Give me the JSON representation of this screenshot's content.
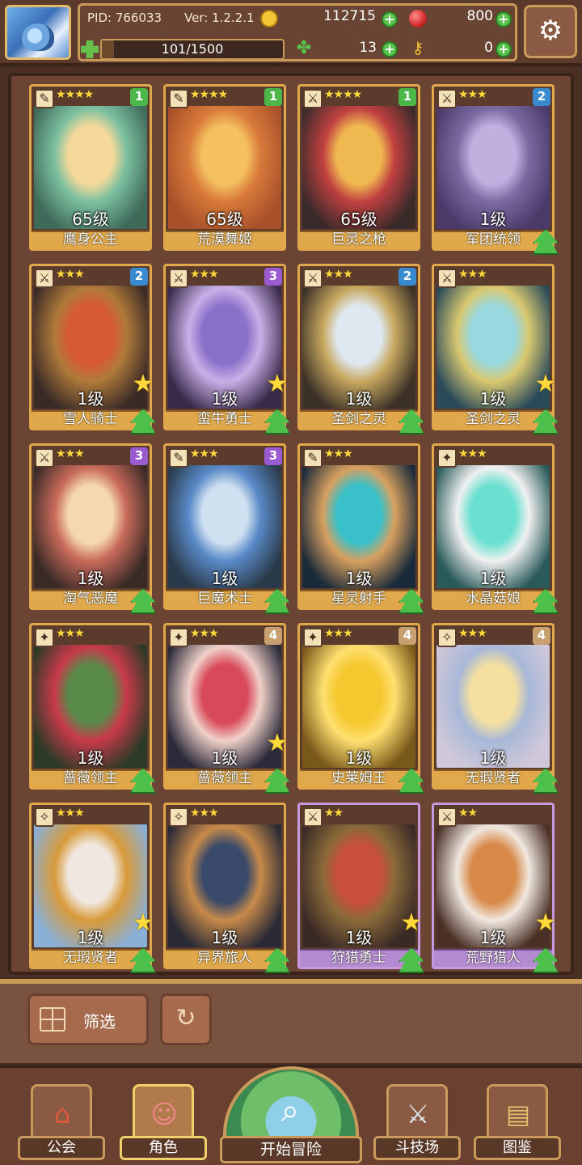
{
  "header": {
    "pid": "PID: 766033",
    "version": "Ver: 1.2.2.1",
    "coins": "112715",
    "gems": "800",
    "exp": "101/1500",
    "exp_progress": 0.067,
    "clover": "13",
    "keys": "0"
  },
  "cards": [
    {
      "name": "鹰身公主",
      "level": "65级",
      "stars": "★★★★",
      "rank": "1",
      "rank_color": "#4cb84a",
      "art": [
        "#3f6a5a",
        "#f5d99a",
        "#7cc0a0"
      ],
      "frame": "gold",
      "cls": "✎",
      "star_badge": false,
      "up_badge": false
    },
    {
      "name": "荒漠舞姬",
      "level": "65级",
      "stars": "★★★★",
      "rank": "1",
      "rank_color": "#4cb84a",
      "art": [
        "#a8502a",
        "#f5c060",
        "#d87a3a"
      ],
      "frame": "gold",
      "cls": "✎",
      "star_badge": false,
      "up_badge": false
    },
    {
      "name": "巨灵之枪",
      "level": "65级",
      "stars": "★★★★",
      "rank": "1",
      "rank_color": "#4cb84a",
      "art": [
        "#3a2a2a",
        "#f0b850",
        "#c04040"
      ],
      "frame": "gold",
      "cls": "⚔",
      "star_badge": false,
      "up_badge": false
    },
    {
      "name": "军团统领",
      "level": "1级",
      "stars": "★★★",
      "rank": "2",
      "rank_color": "#3a8ad0",
      "art": [
        "#4a3a6a",
        "#c0b0e0",
        "#7a6aa0"
      ],
      "frame": "gold",
      "cls": "⚔",
      "star_badge": false,
      "up_badge": true
    },
    {
      "name": "雪人骑士",
      "level": "1级",
      "stars": "★★★",
      "rank": "2",
      "rank_color": "#3a8ad0",
      "art": [
        "#3a2a26",
        "#d85a32",
        "#b07a3a"
      ],
      "frame": "gold",
      "cls": "⚔",
      "star_badge": true,
      "up_badge": true
    },
    {
      "name": "蛮牛勇士",
      "level": "1级",
      "stars": "★★★",
      "rank": "3",
      "rank_color": "#9a5ad0",
      "art": [
        "#3a2a4a",
        "#8a70c8",
        "#c8b0e8"
      ],
      "frame": "gold",
      "cls": "⚔",
      "star_badge": true,
      "up_badge": true
    },
    {
      "name": "圣剑之灵",
      "level": "1级",
      "stars": "★★★",
      "rank": "2",
      "rank_color": "#3a8ad0",
      "art": [
        "#3a3026",
        "#dfe8f0",
        "#c8a860"
      ],
      "frame": "gold",
      "cls": "⚔",
      "star_badge": false,
      "up_badge": true
    },
    {
      "name": "圣剑之灵",
      "level": "1级",
      "stars": "★★★",
      "rank": "",
      "rank_color": "#3a8ad0",
      "art": [
        "#2a4a5a",
        "#9ad8e0",
        "#d8c870"
      ],
      "frame": "gold",
      "cls": "⚔",
      "star_badge": true,
      "up_badge": true
    },
    {
      "name": "淘气恶魔",
      "level": "1级",
      "stars": "★★★",
      "rank": "3",
      "rank_color": "#9a5ad0",
      "art": [
        "#3a2a26",
        "#f5d8b0",
        "#c86a5a"
      ],
      "frame": "gold",
      "cls": "⚔",
      "star_badge": false,
      "up_badge": true
    },
    {
      "name": "巨魔术士",
      "level": "1级",
      "stars": "★★★",
      "rank": "3",
      "rank_color": "#9a5ad0",
      "art": [
        "#2a3a4a",
        "#cfe0f0",
        "#5a8ac8"
      ],
      "frame": "gold",
      "cls": "✎",
      "star_badge": false,
      "up_badge": true
    },
    {
      "name": "星灵射手",
      "level": "1级",
      "stars": "★★★",
      "rank": "",
      "rank_color": "#9a5ad0",
      "art": [
        "#1a2a3a",
        "#3ac0c8",
        "#d8a060"
      ],
      "frame": "gold",
      "cls": "✎",
      "star_badge": false,
      "up_badge": true
    },
    {
      "name": "水晶菇娘",
      "level": "1级",
      "stars": "★★★",
      "rank": "",
      "rank_color": "#9a5ad0",
      "art": [
        "#2a5a5a",
        "#6ae0d0",
        "#f0f0f0"
      ],
      "frame": "gold",
      "cls": "✦",
      "star_badge": false,
      "up_badge": true
    },
    {
      "name": "蔷薇领主",
      "level": "1级",
      "stars": "★★★",
      "rank": "",
      "rank_color": "#9a5ad0",
      "art": [
        "#2a3a26",
        "#5a8a4a",
        "#c83a4a"
      ],
      "frame": "gold",
      "cls": "✦",
      "star_badge": false,
      "up_badge": true
    },
    {
      "name": "蔷薇领主",
      "level": "1级",
      "stars": "★★★",
      "rank": "4",
      "rank_color": "#c8a070",
      "art": [
        "#2a2a3a",
        "#d84a5a",
        "#f0d0c8"
      ],
      "frame": "gold",
      "cls": "✦",
      "star_badge": true,
      "up_badge": true
    },
    {
      "name": "史莱姆王",
      "level": "1级",
      "stars": "★★★",
      "rank": "4",
      "rank_color": "#c8a070",
      "art": [
        "#7a5a1a",
        "#f5c830",
        "#ffe070"
      ],
      "frame": "gold",
      "cls": "✦",
      "star_badge": false,
      "up_badge": true
    },
    {
      "name": "无瑕贤者",
      "level": "1级",
      "stars": "★★★",
      "rank": "4",
      "rank_color": "#c8a070",
      "art": [
        "#d0c8d8",
        "#f5e0a0",
        "#a8b8d8"
      ],
      "frame": "gold",
      "cls": "✧",
      "star_badge": false,
      "up_badge": true
    },
    {
      "name": "无瑕贤者",
      "level": "1级",
      "stars": "★★★",
      "rank": "",
      "rank_color": "#c8a070",
      "art": [
        "#8ab0d8",
        "#f0e8e0",
        "#d89a3a"
      ],
      "frame": "gold",
      "cls": "✧",
      "star_badge": true,
      "up_badge": true
    },
    {
      "name": "异界旅人",
      "level": "1级",
      "stars": "★★★",
      "rank": "",
      "rank_color": "#c8a070",
      "art": [
        "#2a2a36",
        "#3a4a6a",
        "#c88a4a"
      ],
      "frame": "gold",
      "cls": "✧",
      "star_badge": false,
      "up_badge": true
    },
    {
      "name": "狩猎勇士",
      "level": "1级",
      "stars": "★★",
      "rank": "",
      "rank_color": "#c8a070",
      "art": [
        "#3a2a26",
        "#c8503a",
        "#8a6a3a"
      ],
      "frame": "purple",
      "cls": "⚔",
      "star_badge": true,
      "up_badge": true
    },
    {
      "name": "荒野猎人",
      "level": "1级",
      "stars": "★★",
      "rank": "",
      "rank_color": "#c8a070",
      "art": [
        "#4a3026",
        "#d88a4a",
        "#f0e8e0"
      ],
      "frame": "purple",
      "cls": "⚔",
      "star_badge": true,
      "up_badge": true
    }
  ],
  "filter": {
    "label": "筛选"
  },
  "nav": {
    "guild": "公会",
    "character": "角色",
    "adventure": "开始冒险",
    "arena": "斗技场",
    "codex": "图鉴"
  }
}
